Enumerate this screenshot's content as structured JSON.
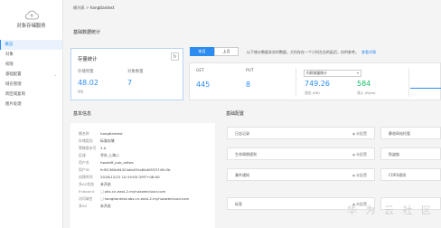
{
  "sidebar": {
    "brand": "对象存储服务",
    "items": [
      {
        "label": "概览",
        "active": true,
        "expand": false
      },
      {
        "label": "对象",
        "active": false,
        "expand": false
      },
      {
        "label": "权限",
        "active": false,
        "expand": false
      },
      {
        "label": "基础配置",
        "active": false,
        "expand": true
      },
      {
        "label": "域名管理",
        "active": false,
        "expand": false
      },
      {
        "label": "跨区域复制",
        "active": false,
        "expand": false
      },
      {
        "label": "图片处理",
        "active": false,
        "expand": false
      }
    ]
  },
  "breadcrumb": {
    "root": "桶列表",
    "sep": ">",
    "current": "hangtiantest"
  },
  "basic_stats": {
    "title": "基础数据统计",
    "storage": {
      "title": "存量统计",
      "refresh_icon": "refresh-icon",
      "capacity_label": "存储用量",
      "capacity_value": "48.02",
      "capacity_unit": "MB",
      "objects_label": "对象数量",
      "objects_value": "7"
    },
    "tabs": [
      {
        "label": "本月",
        "active": true
      },
      {
        "label": "上月",
        "active": false
      }
    ],
    "note": "以下统计数据非实时数据，大约存在一个小时左右的延迟，仅供参考。",
    "note_link": "查看详情",
    "requests": {
      "get_label": "GET",
      "get_value": "445",
      "put_label": "PUT",
      "put_value": "8"
    },
    "traffic": {
      "select_value": "内网流量统计",
      "out_value": "749.26",
      "out_label": "流出 (KB)",
      "in_value": "584",
      "in_label": "流入 (Byte)"
    }
  },
  "basic_info": {
    "title": "基本信息",
    "rows": [
      {
        "label": "桶名称",
        "value": "hangtiantest"
      },
      {
        "label": "存储类别",
        "value": "标准存储"
      },
      {
        "label": "策略版本号",
        "value": "3.0"
      },
      {
        "label": "区域",
        "value": "华东-上海二"
      },
      {
        "label": "用户名",
        "value": "hwstaff_pub_edlws"
      },
      {
        "label": "用户ID",
        "value": "fc9f1360df4424ab491a84d0535749c3b"
      },
      {
        "label": "创建时间",
        "value": "2018/12/22 10:19:00 GMT+08:00"
      },
      {
        "label": "多AZ状态",
        "value": "未开启"
      },
      {
        "label": "Endpoint",
        "value": "obs.cn-east-2.myhuaweicloud.com"
      },
      {
        "label": "访问域名",
        "value": "hangtiantest.obs.cn-east-2.myhuaweicloud.com"
      },
      {
        "label": "多AZ",
        "value": "未开启"
      }
    ]
  },
  "basic_config": {
    "title": "基础配置",
    "tiles": [
      {
        "label": "日志记录",
        "status": "未配置"
      },
      {
        "label": "静态网站托管",
        "status": ""
      },
      {
        "label": "生命周期规则",
        "status": "未配置"
      },
      {
        "label": "防盗链",
        "status": ""
      },
      {
        "label": "事件通知",
        "status": "未配置"
      },
      {
        "label": "CORS规则",
        "status": ""
      },
      {
        "label": "标签",
        "status": "未配置"
      },
      {
        "label": "",
        "status": ""
      }
    ]
  },
  "watermark": "华 为 云 社 区"
}
